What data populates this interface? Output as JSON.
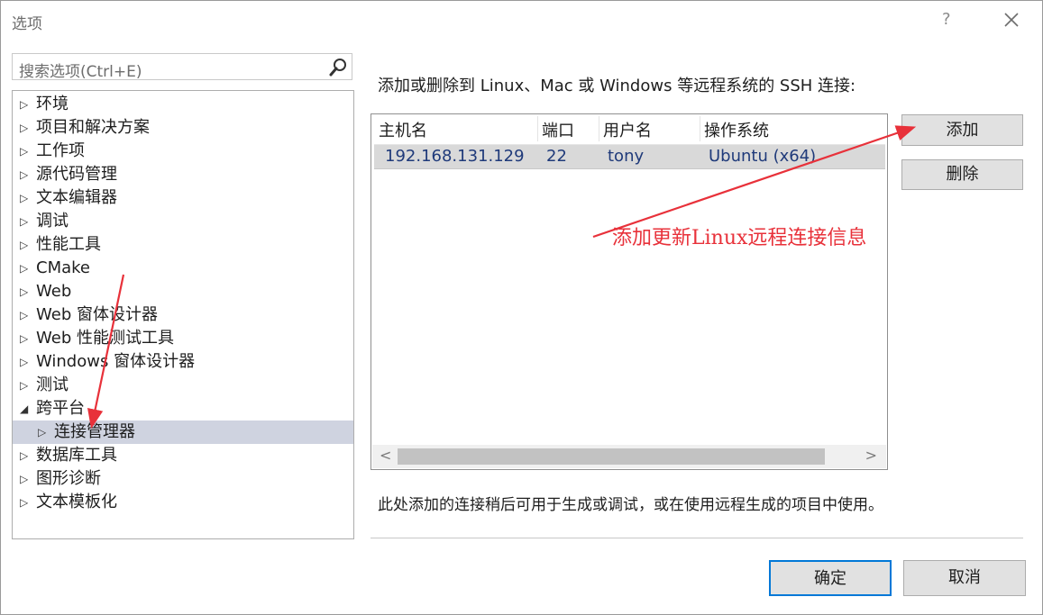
{
  "window": {
    "title": "选项",
    "help_glyph": "?",
    "close_icon": "close-icon"
  },
  "search": {
    "placeholder": "搜索选项(Ctrl+E)"
  },
  "tree": {
    "items": [
      {
        "label": "环境",
        "expanded": false,
        "level": 0
      },
      {
        "label": "项目和解决方案",
        "expanded": false,
        "level": 0
      },
      {
        "label": "工作项",
        "expanded": false,
        "level": 0
      },
      {
        "label": "源代码管理",
        "expanded": false,
        "level": 0
      },
      {
        "label": "文本编辑器",
        "expanded": false,
        "level": 0
      },
      {
        "label": "调试",
        "expanded": false,
        "level": 0
      },
      {
        "label": "性能工具",
        "expanded": false,
        "level": 0
      },
      {
        "label": "CMake",
        "expanded": false,
        "level": 0
      },
      {
        "label": "Web",
        "expanded": false,
        "level": 0
      },
      {
        "label": "Web 窗体设计器",
        "expanded": false,
        "level": 0
      },
      {
        "label": "Web 性能测试工具",
        "expanded": false,
        "level": 0
      },
      {
        "label": "Windows 窗体设计器",
        "expanded": false,
        "level": 0
      },
      {
        "label": "测试",
        "expanded": false,
        "level": 0
      },
      {
        "label": "跨平台",
        "expanded": true,
        "level": 0
      },
      {
        "label": "连接管理器",
        "expanded": false,
        "level": 1,
        "selected": true
      },
      {
        "label": "数据库工具",
        "expanded": false,
        "level": 0
      },
      {
        "label": "图形诊断",
        "expanded": false,
        "level": 0
      },
      {
        "label": "文本模板化",
        "expanded": false,
        "level": 0
      }
    ],
    "collapsed_glyph": "▷",
    "expanded_glyph": "◢"
  },
  "main": {
    "description": "添加或删除到 Linux、Mac 或 Windows 等远程系统的 SSH 连接:",
    "columns": [
      "主机名",
      "端口",
      "用户名",
      "操作系统"
    ],
    "rows": [
      {
        "host": "192.168.131.129",
        "port": "22",
        "user": "tony",
        "os": "Ubuntu (x64)"
      }
    ],
    "scroll_left": "<",
    "scroll_right": ">",
    "add_label": "添加",
    "delete_label": "删除",
    "note": "此处添加的连接稍后可用于生成或调试，或在使用远程生成的项目中使用。"
  },
  "footer": {
    "ok_label": "确定",
    "cancel_label": "取消"
  },
  "annotation": {
    "text": "添加更新Linux远程连接信息",
    "color": "#e8313a"
  },
  "colors": {
    "accent": "#0078d7",
    "selection": "#cfd3e0",
    "annotation_red": "#e8313a",
    "row_text": "#1f3a7a"
  }
}
